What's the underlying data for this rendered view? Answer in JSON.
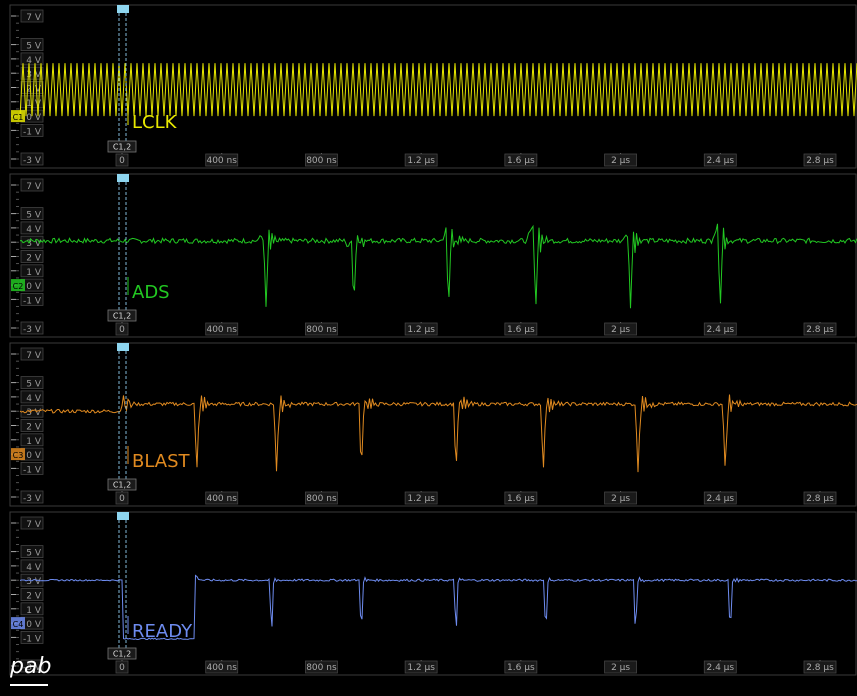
{
  "chart_data": [
    {
      "type": "line",
      "channel": "LCLK",
      "color": "#e8e800",
      "channel_marker": "C1",
      "ylim": [
        -3,
        7
      ],
      "yticks": [
        "7 V",
        "5 V",
        "4 V",
        "3 V",
        "2 V",
        "1 V",
        "0 V",
        "-1 V",
        "-3 V"
      ],
      "yticks_values": [
        7,
        5,
        4,
        3,
        2,
        1,
        0,
        -1,
        -3
      ],
      "xlim_ns": [
        0,
        3000
      ],
      "xticks": [
        "0",
        "400 ns",
        "800 ns",
        "1.2 µs",
        "1.6 µs",
        "2 µs",
        "2.4 µs",
        "2.8 µs"
      ],
      "xticks_ns": [
        0,
        400,
        800,
        1200,
        1600,
        2000,
        2400,
        2800
      ],
      "cursor_label": "C1,2",
      "waveform": {
        "kind": "clock",
        "period_ns": 15,
        "low_v": 0,
        "high_v": 3.7
      }
    },
    {
      "type": "line",
      "channel": "ADS",
      "color": "#22c822",
      "channel_marker": "C2",
      "ylim": [
        -3,
        7
      ],
      "yticks": [
        "7 V",
        "5 V",
        "4 V",
        "3 V",
        "2 V",
        "1 V",
        "0 V",
        "-1 V",
        "-3 V"
      ],
      "yticks_values": [
        7,
        5,
        4,
        3,
        2,
        1,
        0,
        -1,
        -3
      ],
      "xlim_ns": [
        0,
        3000
      ],
      "xticks": [
        "0",
        "400 ns",
        "800 ns",
        "1.2 µs",
        "1.6 µs",
        "2 µs",
        "2.4 µs",
        "2.8 µs"
      ],
      "xticks_ns": [
        0,
        400,
        800,
        1200,
        1600,
        2000,
        2400,
        2800
      ],
      "cursor_label": "C1,2",
      "waveform": {
        "kind": "ads",
        "baseline_v": 3.1,
        "noise_v": 0.35,
        "pulse_times_ns": [
          578,
          930,
          1310,
          1660,
          2040,
          2400
        ],
        "pulse_low_v": -1.7
      }
    },
    {
      "type": "line",
      "channel": "BLAST",
      "color": "#e08a20",
      "channel_marker": "C3",
      "ylim": [
        -3,
        7
      ],
      "yticks": [
        "7 V",
        "5 V",
        "4 V",
        "3 V",
        "2 V",
        "1 V",
        "0 V",
        "-1 V",
        "-3 V"
      ],
      "yticks_values": [
        7,
        5,
        4,
        3,
        2,
        1,
        0,
        -1,
        -3
      ],
      "xlim_ns": [
        0,
        3000
      ],
      "xticks": [
        "0",
        "400 ns",
        "800 ns",
        "1.2 µs",
        "1.6 µs",
        "2 µs",
        "2.4 µs",
        "2.8 µs"
      ],
      "xticks_ns": [
        0,
        400,
        800,
        1200,
        1600,
        2000,
        2400,
        2800
      ],
      "cursor_label": "C1,2",
      "waveform": {
        "kind": "blast",
        "baseline_v": 3.0,
        "high_v": 3.5,
        "noise_v": 0.25,
        "pulse_times_ns": [
          300,
          620,
          960,
          1340,
          1690,
          2070,
          2420
        ],
        "pulse_low_v": -1.3
      }
    },
    {
      "type": "line",
      "channel": "READY",
      "color": "#6e8cf0",
      "channel_marker": "C4",
      "ylim": [
        -3,
        7
      ],
      "yticks": [
        "7 V",
        "5 V",
        "4 V",
        "3 V",
        "2 V",
        "1 V",
        "0 V",
        "-1 V",
        "-3 V"
      ],
      "yticks_values": [
        7,
        5,
        4,
        3,
        2,
        1,
        0,
        -1,
        -3
      ],
      "xlim_ns": [
        0,
        3000
      ],
      "xticks": [
        "0",
        "400 ns",
        "800 ns",
        "1.2 µs",
        "1.6 µs",
        "2 µs",
        "2.4 µs",
        "2.8 µs"
      ],
      "xticks_ns": [
        0,
        400,
        800,
        1200,
        1600,
        2000,
        2400,
        2800
      ],
      "cursor_label": "C1,2",
      "waveform": {
        "kind": "ready",
        "pre_v": 3.0,
        "high_v": 3.0,
        "low_before_ns": [
          0,
          10,
          300
        ],
        "pulse_times_ns": [
          600,
          960,
          1340,
          1700,
          2060,
          2440
        ],
        "pulse_low_v": -1.1
      }
    }
  ],
  "brand": {
    "logo_text": "pab"
  }
}
